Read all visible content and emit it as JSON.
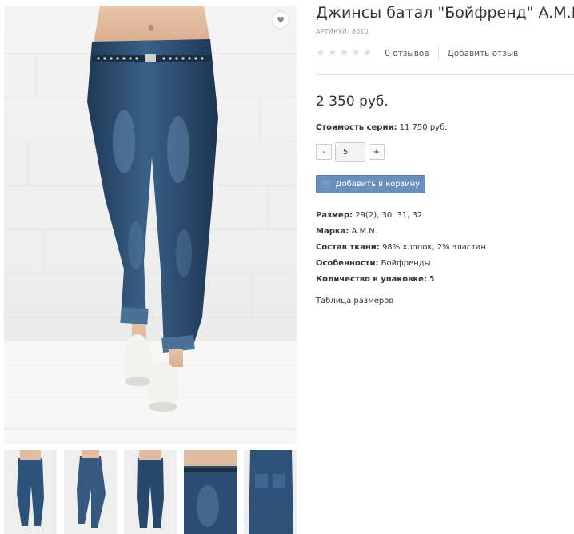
{
  "product": {
    "title": "Джинсы батал \"Бойфренд\" A.M.N",
    "sku_label": "АРТИКУЛ: 8010",
    "reviews_count": "0 отзывов",
    "add_review": "Добавить отзыв",
    "rating_stars": 0,
    "price": "2 350 руб.",
    "series_label": "Стоимость серии:",
    "series_value": "11 750 руб.",
    "qty_minus": "-",
    "qty_value": "5",
    "qty_plus": "+",
    "add_to_cart": "Добавить в корзину",
    "specs": [
      {
        "label": "Размер:",
        "value": "29(2), 30, 31, 32"
      },
      {
        "label": "Марка:",
        "value": "A.M.N."
      },
      {
        "label": "Состав ткани:",
        "value": "98% хлопок, 2% эластан"
      },
      {
        "label": "Особенности:",
        "value": "Бойфренды"
      },
      {
        "label": "Количество в упаковке:",
        "value": "5"
      }
    ],
    "size_table_link": "Таблица размеров"
  },
  "icons": {
    "favorite": "heart-icon",
    "cart": "cart-icon",
    "star": "star-icon"
  },
  "colors": {
    "cart_button": "#6b8fbd",
    "denim": "#2b4a6b",
    "star_empty": "#dddddd"
  }
}
